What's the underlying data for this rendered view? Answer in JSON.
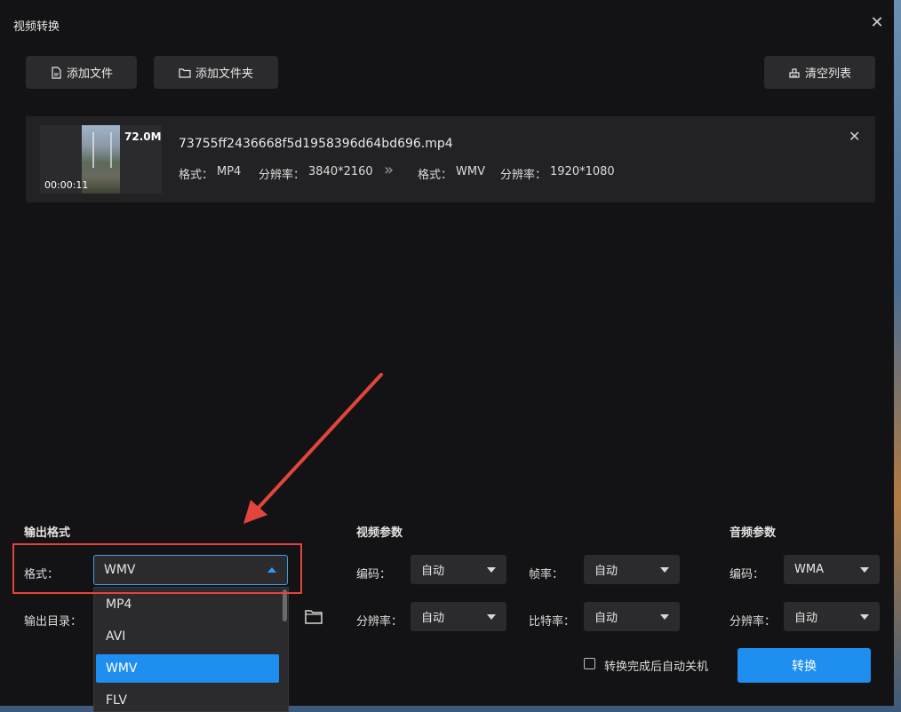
{
  "window": {
    "title": "视频转换"
  },
  "toolbar": {
    "add_file": "添加文件",
    "add_folder": "添加文件夹",
    "clear_list": "清空列表"
  },
  "file": {
    "name": "73755ff2436668f5d1958396d64bd696.mp4",
    "size": "72.0M",
    "duration": "00:00:11",
    "src_format_label": "格式：",
    "src_format": "MP4",
    "src_res_label": "分辨率：",
    "src_res": "3840*2160",
    "arrow": "»",
    "dst_format_label": "格式：",
    "dst_format": "WMV",
    "dst_res_label": "分辨率：",
    "dst_res": "1920*1080"
  },
  "output": {
    "section": "输出格式",
    "format_label": "格式：",
    "format_value": "WMV",
    "dir_label": "输出目录：",
    "options": [
      "MP4",
      "AVI",
      "WMV",
      "FLV"
    ],
    "selected_index": 2
  },
  "video": {
    "section": "视频参数",
    "codec_label": "编码：",
    "codec_value": "自动",
    "fps_label": "帧率：",
    "fps_value": "自动",
    "res_label": "分辨率：",
    "res_value": "自动",
    "bitrate_label": "比特率：",
    "bitrate_value": "自动"
  },
  "audio": {
    "section": "音频参数",
    "codec_label": "编码：",
    "codec_value": "WMA",
    "res_label": "分辨率：",
    "res_value": "自动"
  },
  "footer": {
    "shutdown_label": "转换完成后自动关机",
    "convert": "转换"
  },
  "colors": {
    "accent": "#1e8ff0",
    "annotation": "#e2453b",
    "panel": "#131315"
  }
}
